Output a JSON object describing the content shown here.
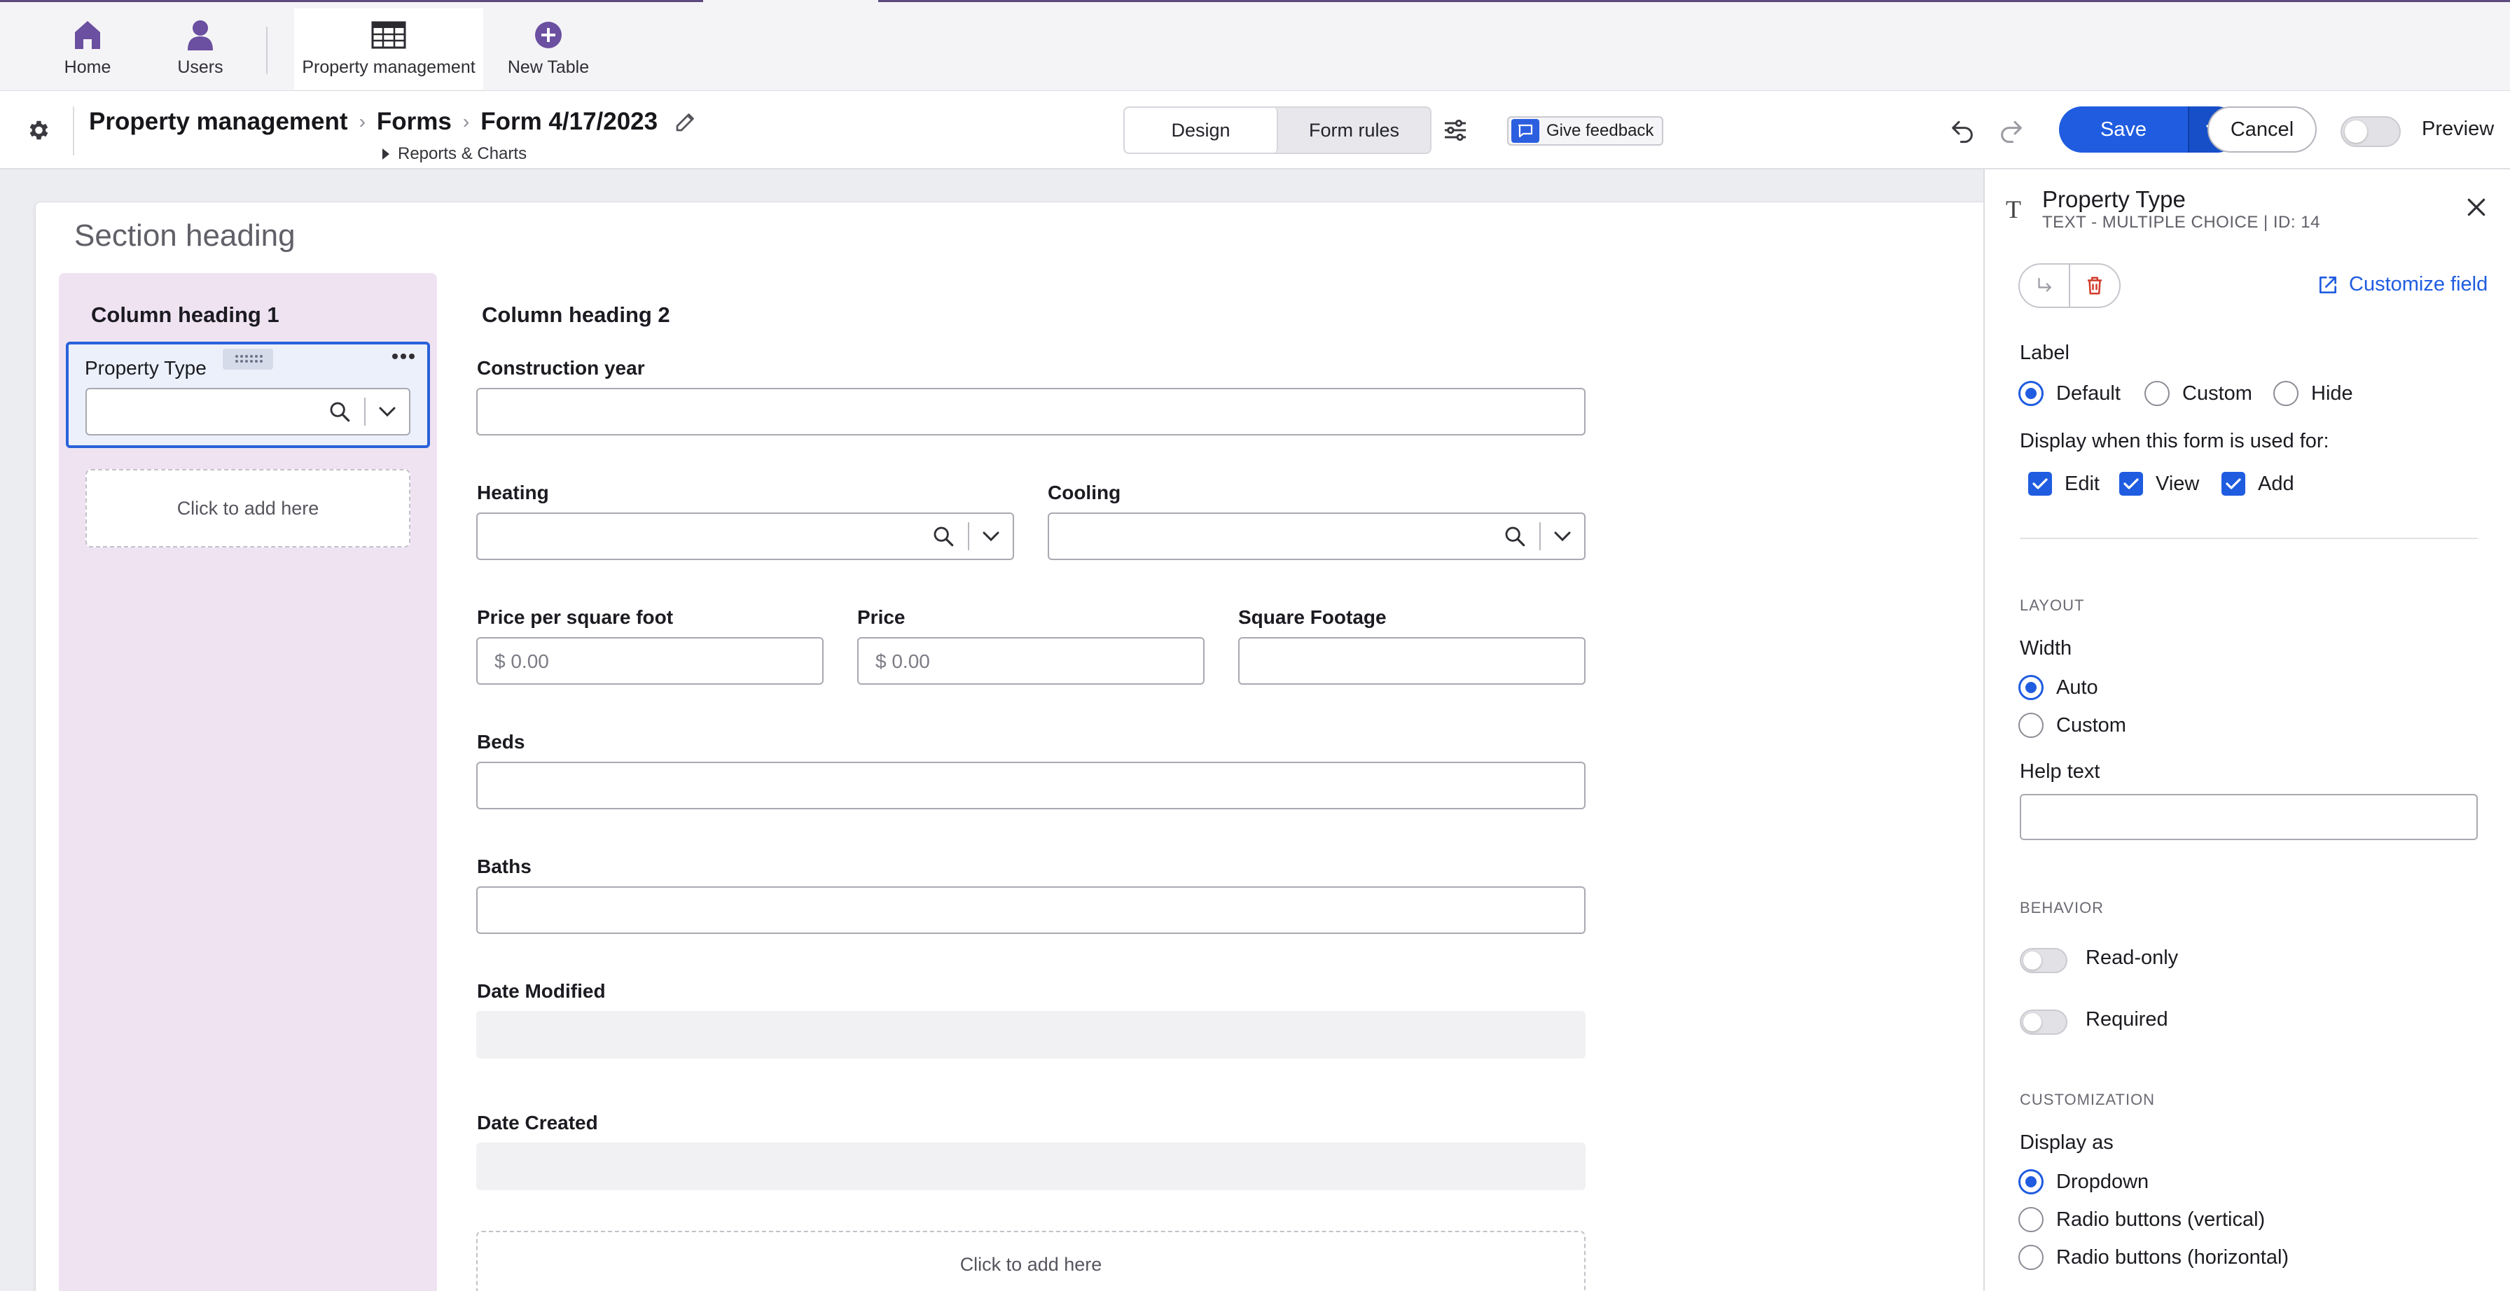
{
  "nav": {
    "tabs": [
      {
        "label": "Home",
        "icon": "home-icon"
      },
      {
        "label": "Users",
        "icon": "user-icon"
      },
      {
        "label": "Property management",
        "icon": "table-icon"
      },
      {
        "label": "New Table",
        "icon": "plus-circle-icon"
      }
    ],
    "active_tab": "Property management"
  },
  "header": {
    "breadcrumb": [
      "Property management",
      "Forms",
      "Form 4/17/2023"
    ],
    "sub_link": "Reports & Charts",
    "segments": [
      "Design",
      "Form rules"
    ],
    "active_segment": "Design",
    "feedback_label": "Give feedback",
    "save_label": "Save",
    "cancel_label": "Cancel",
    "preview_label": "Preview",
    "preview_enabled": false
  },
  "form": {
    "section_heading": "Section heading",
    "column1": {
      "heading": "Column heading 1",
      "selected_field": "Property Type",
      "add_here": "Click to add here"
    },
    "column2": {
      "heading": "Column heading 2",
      "fields": {
        "construction_year": "Construction year",
        "heating": "Heating",
        "cooling": "Cooling",
        "price_per_sqft": "Price per square foot",
        "price_per_sqft_placeholder": "$ 0.00",
        "price": "Price",
        "price_placeholder": "$ 0.00",
        "square_footage": "Square Footage",
        "beds": "Beds",
        "baths": "Baths",
        "date_modified": "Date Modified",
        "date_created": "Date Created"
      },
      "add_here": "Click to add here"
    }
  },
  "panel": {
    "title": "Property Type",
    "subtitle": "TEXT - MULTIPLE CHOICE | ID: 14",
    "customize_label": "Customize field",
    "label_heading": "Label",
    "label_options": [
      "Default",
      "Custom",
      "Hide"
    ],
    "label_selected": "Default",
    "display_when_heading": "Display when this form is used for:",
    "display_when": [
      {
        "label": "Edit",
        "checked": true
      },
      {
        "label": "View",
        "checked": true
      },
      {
        "label": "Add",
        "checked": true
      }
    ],
    "layout_caption": "LAYOUT",
    "width_heading": "Width",
    "width_options": [
      "Auto",
      "Custom"
    ],
    "width_selected": "Auto",
    "help_text_heading": "Help text",
    "behavior_caption": "BEHAVIOR",
    "read_only_label": "Read-only",
    "read_only": false,
    "required_label": "Required",
    "required": false,
    "customization_caption": "CUSTOMIZATION",
    "display_as_heading": "Display as",
    "display_as_options": [
      "Dropdown",
      "Radio buttons (vertical)",
      "Radio buttons (horizontal)"
    ],
    "display_as_selected": "Dropdown"
  },
  "colors": {
    "accent": "#1f5ce0",
    "nav_icon": "#6b4fa0",
    "column_bg": "#efe3f2",
    "delete_icon": "#d23a2a"
  }
}
